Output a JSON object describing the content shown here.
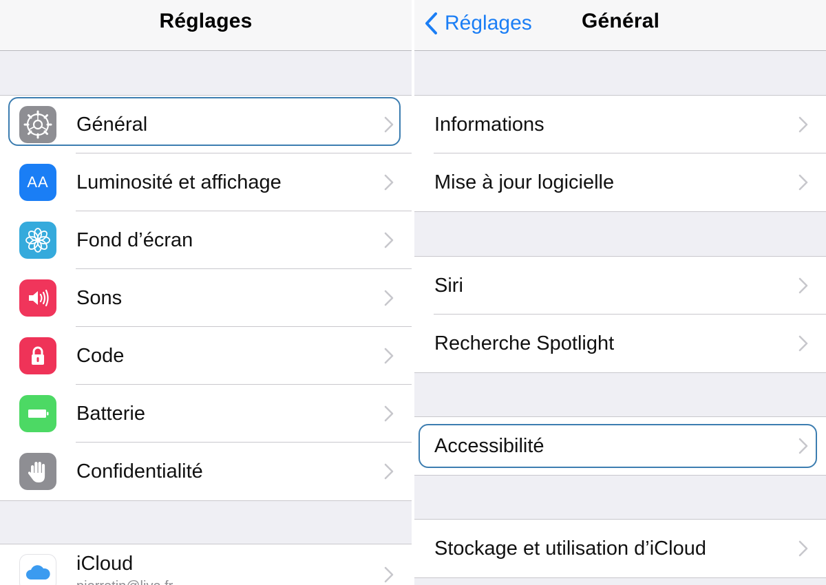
{
  "left": {
    "nav_title": "Réglages",
    "items": [
      {
        "label": "Général",
        "icon": "gear-icon"
      },
      {
        "label": "Luminosité et affichage",
        "icon": "text-size-icon",
        "icon_text": "AA"
      },
      {
        "label": "Fond d’écran",
        "icon": "flower-icon"
      },
      {
        "label": "Sons",
        "icon": "speaker-icon"
      },
      {
        "label": "Code",
        "icon": "lock-icon"
      },
      {
        "label": "Batterie",
        "icon": "battery-icon"
      },
      {
        "label": "Confidentialité",
        "icon": "hand-icon"
      }
    ],
    "icloud": {
      "label": "iCloud",
      "subtitle": "pierretin@live.fr",
      "icon": "cloud-icon"
    }
  },
  "right": {
    "back_label": "Réglages",
    "nav_title": "Général",
    "groups": [
      {
        "items": [
          "Informations",
          "Mise à jour logicielle"
        ]
      },
      {
        "items": [
          "Siri",
          "Recherche Spotlight"
        ]
      },
      {
        "items": [
          "Accessibilité"
        ]
      },
      {
        "items": [
          "Stockage et utilisation d’iCloud"
        ]
      }
    ]
  },
  "colors": {
    "accent": "#1b7ef5",
    "highlight": "#3c7db0",
    "icon_general": "#8e8e93",
    "icon_display": "#1a7ef5",
    "icon_wallpaper": "#35aadc",
    "icon_sounds": "#f0355b",
    "icon_passcode": "#ef3358",
    "icon_battery": "#4cd964",
    "icon_privacy": "#8e8e93"
  }
}
